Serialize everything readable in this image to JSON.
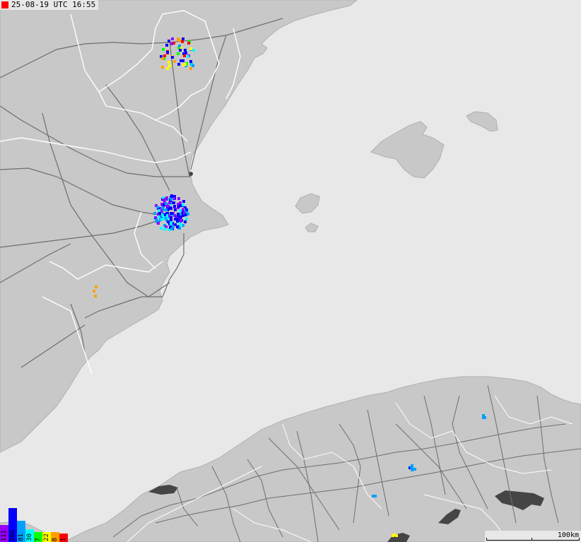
{
  "header": {
    "live_indicator_color": "#ff0000",
    "timestamp": "25-08-19 UTC 16:55"
  },
  "map": {
    "water_color": "#e8e8e8",
    "land_color": "#c8c8c8",
    "road_color": "#707070",
    "border_color": "#ffffff",
    "lake_color": "#454545"
  },
  "legend": {
    "bins": [
      {
        "label": "111",
        "color": "#9600ff"
      },
      {
        "label": "100",
        "color": "#0000ff"
      },
      {
        "label": "81",
        "color": "#00a0ff"
      },
      {
        "label": "30",
        "color": "#00ffff"
      },
      {
        "label": "7",
        "color": "#00ff00"
      },
      {
        "label": "22",
        "color": "#ffff00"
      },
      {
        "label": "8",
        "color": "#ffa000"
      },
      {
        "label": "1",
        "color": "#ff0000"
      }
    ]
  },
  "scale_bar": {
    "label": "100km"
  }
}
